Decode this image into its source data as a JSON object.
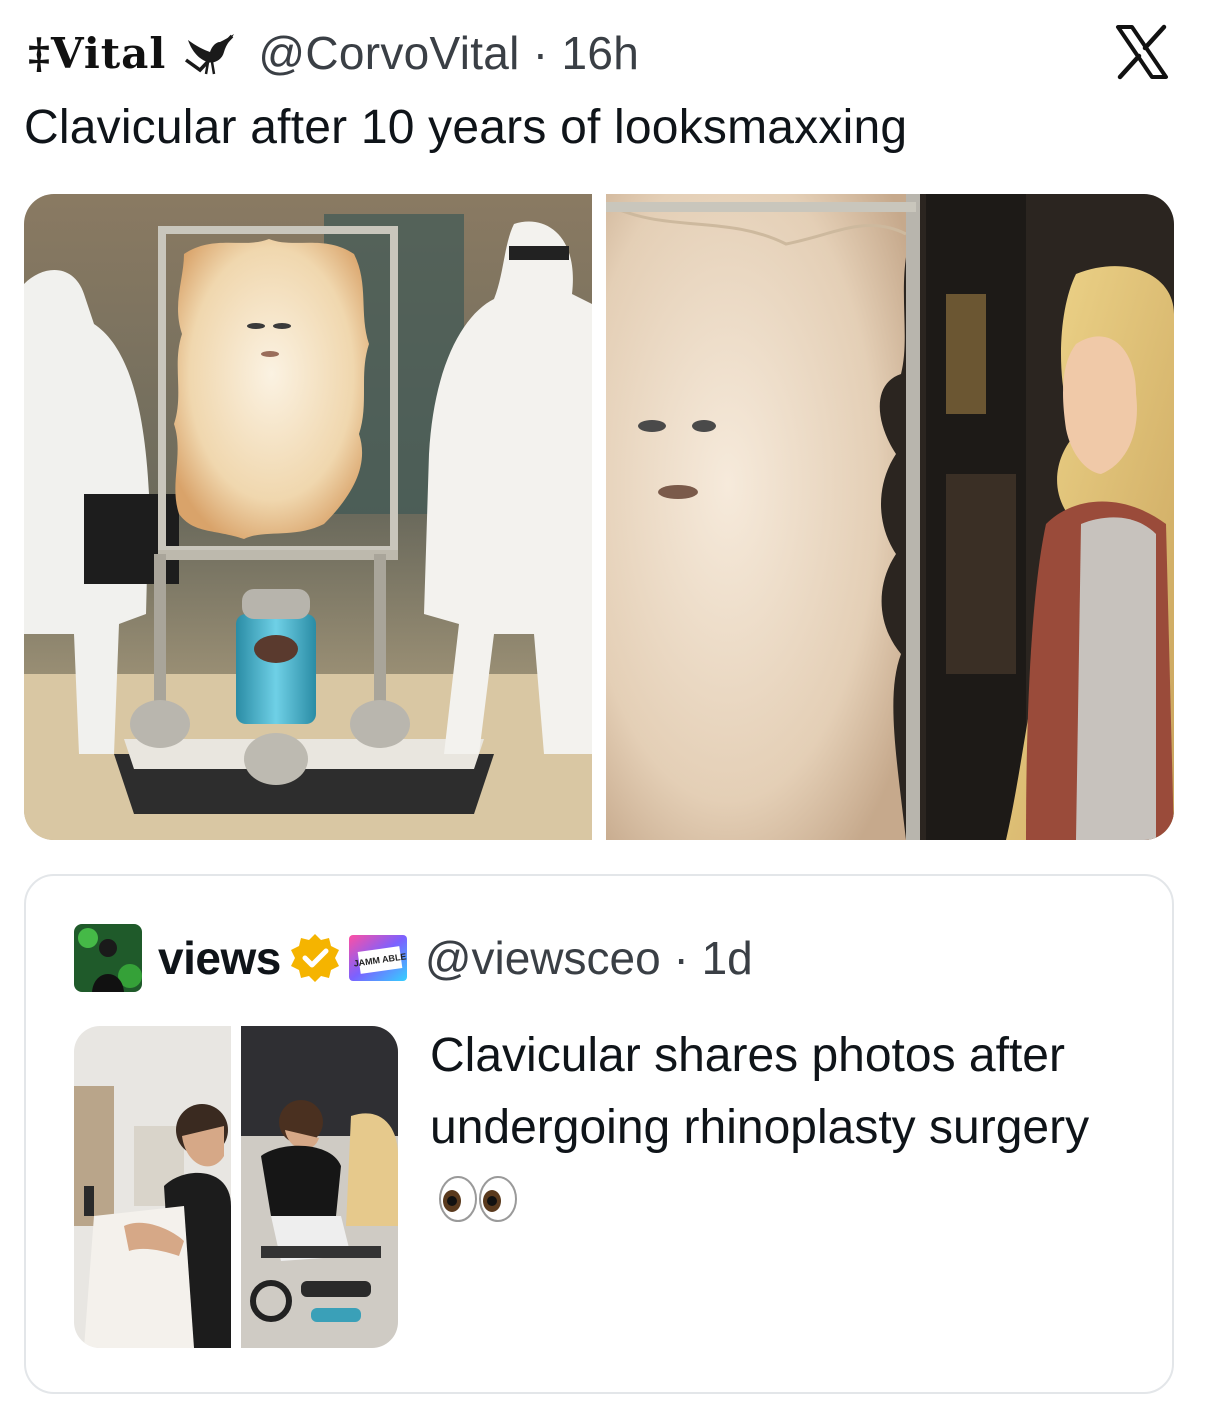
{
  "post": {
    "display_name": "‡Vital",
    "handle_time": "@CorvoVital · 16h",
    "text": "Clavicular after 10 years of looksmaxxing",
    "icons": [
      "bird-icon",
      "x-logo-icon"
    ]
  },
  "quoted_post": {
    "display_name": "views",
    "handle_time": "@viewsceo · 1d",
    "affiliate_badge": "JAMM ABLE",
    "text": "Clavicular shares photos after undergoing rhinoplasty surgery",
    "icons": [
      "verified-badge-icon",
      "eyes-emoji-icon"
    ]
  },
  "colors": {
    "text": "#0f1419",
    "secondary_text": "#3a3f45",
    "border": "#e3e6e9",
    "verified_gold": "#f5b400"
  }
}
